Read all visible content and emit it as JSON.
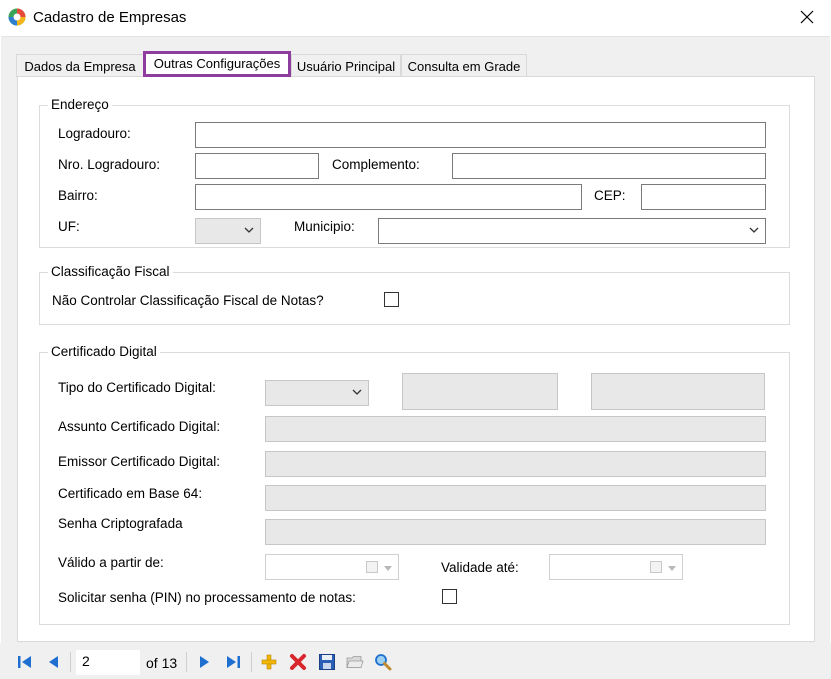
{
  "window": {
    "title": "Cadastro de Empresas",
    "icon": "app-logo-icon",
    "close_icon": "close-icon"
  },
  "tabs": [
    {
      "label": "Dados da Empresa",
      "active": false
    },
    {
      "label": "Outras Configurações",
      "active": true
    },
    {
      "label": "Usuário Principal",
      "active": false
    },
    {
      "label": "Consulta em Grade",
      "active": false
    }
  ],
  "endereco": {
    "legend": "Endereço",
    "logradouro_label": "Logradouro:",
    "logradouro_value": "",
    "nro_label": "Nro. Logradouro:",
    "nro_value": "",
    "complemento_label": "Complemento:",
    "complemento_value": "",
    "bairro_label": "Bairro:",
    "bairro_value": "",
    "cep_label": "CEP:",
    "cep_value": "",
    "uf_label": "UF:",
    "uf_value": "",
    "municipio_label": "Municipio:",
    "municipio_value": ""
  },
  "classificacao": {
    "legend": "Classificação Fiscal",
    "nao_controlar_label": "Não Controlar Classificação Fiscal de Notas?",
    "nao_controlar_checked": false
  },
  "certificado": {
    "legend": "Certificado Digital",
    "tipo_label": "Tipo do Certificado Digital:",
    "tipo_value": "",
    "assunto_label": "Assunto Certificado Digital:",
    "emissor_label": "Emissor Certificado Digital:",
    "base64_label": "Certificado em Base 64:",
    "senha_label": "Senha Criptografada",
    "valido_label": "Válido a partir de:",
    "validade_label": "Validade até:",
    "solicitar_pin_label": "Solicitar senha (PIN) no processamento de notas:",
    "solicitar_pin_checked": false
  },
  "navigator": {
    "position": "2",
    "of_text": "of 13",
    "buttons": [
      "first-record-icon",
      "prev-record-icon",
      "next-record-icon",
      "last-record-icon",
      "add-icon",
      "delete-icon",
      "save-icon",
      "open-folder-icon",
      "search-icon"
    ]
  },
  "colors": {
    "active_tab_border": "#8e3c9e",
    "nav_blue": "#1e6fd0",
    "add_yellow": "#f2b705",
    "delete_red": "#d9252c"
  }
}
